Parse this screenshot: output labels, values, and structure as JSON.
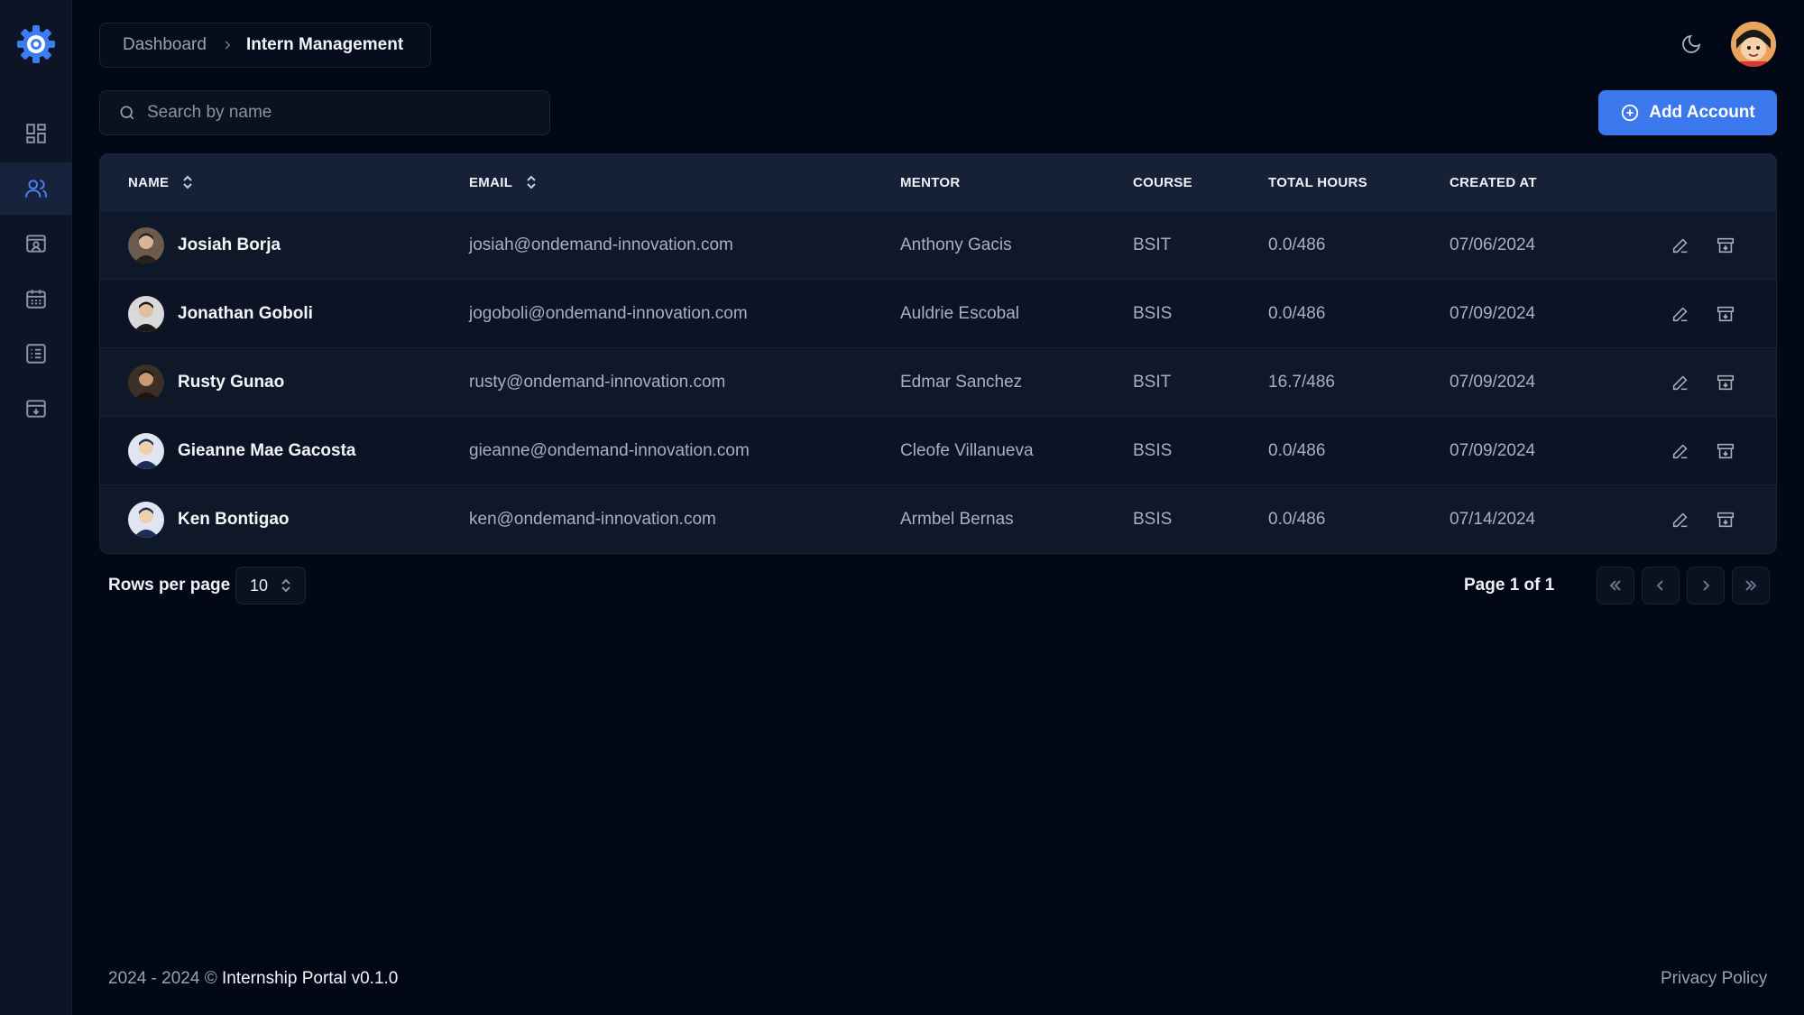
{
  "breadcrumb": {
    "parent": "Dashboard",
    "current": "Intern Management"
  },
  "search": {
    "placeholder": "Search by name",
    "value": ""
  },
  "actions": {
    "add_account": "Add Account"
  },
  "sidebar": {
    "items": [
      {
        "icon": "dashboard-icon",
        "active": false
      },
      {
        "icon": "users-icon",
        "active": true
      },
      {
        "icon": "id-card-icon",
        "active": false
      },
      {
        "icon": "calendar-icon",
        "active": false
      },
      {
        "icon": "list-icon",
        "active": false
      },
      {
        "icon": "archive-icon",
        "active": false
      }
    ]
  },
  "table": {
    "headers": {
      "name": "NAME",
      "email": "EMAIL",
      "mentor": "MENTOR",
      "course": "COURSE",
      "total_hours": "TOTAL HOURS",
      "created_at": "CREATED AT"
    },
    "rows": [
      {
        "name": "Josiah Borja",
        "email": "josiah@ondemand-innovation.com",
        "mentor": "Anthony Gacis",
        "course": "BSIT",
        "hours": "0.0/486",
        "created": "07/06/2024"
      },
      {
        "name": "Jonathan Goboli",
        "email": "jogoboli@ondemand-innovation.com",
        "mentor": "Auldrie Escobal",
        "course": "BSIS",
        "hours": "0.0/486",
        "created": "07/09/2024"
      },
      {
        "name": "Rusty Gunao",
        "email": "rusty@ondemand-innovation.com",
        "mentor": "Edmar Sanchez",
        "course": "BSIT",
        "hours": "16.7/486",
        "created": "07/09/2024"
      },
      {
        "name": "Gieanne Mae Gacosta",
        "email": "gieanne@ondemand-innovation.com",
        "mentor": "Cleofe Villanueva",
        "course": "BSIS",
        "hours": "0.0/486",
        "created": "07/09/2024"
      },
      {
        "name": "Ken Bontigao",
        "email": "ken@ondemand-innovation.com",
        "mentor": "Armbel Bernas",
        "course": "BSIS",
        "hours": "0.0/486",
        "created": "07/14/2024"
      }
    ]
  },
  "pagination": {
    "rows_label": "Rows per page",
    "rows_value": "10",
    "page_info": "Page 1 of 1"
  },
  "footer": {
    "copyright": "2024 - 2024 ©",
    "brand": "Internship Portal v0.1.0",
    "privacy": "Privacy Policy"
  },
  "colors": {
    "background": "#030817",
    "sidebar": "#0c1425",
    "accent": "#3b78ee",
    "active_nav": "#4b83f5"
  }
}
